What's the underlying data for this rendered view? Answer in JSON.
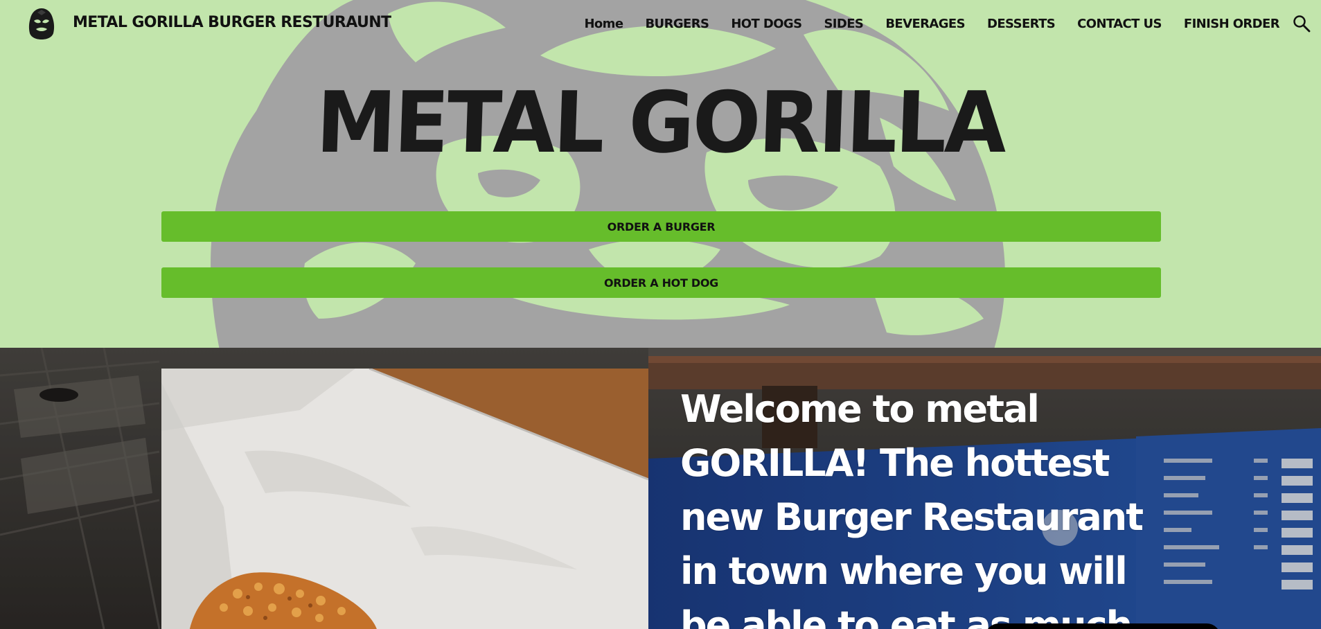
{
  "header": {
    "site_title": "METAL GORILLA BURGER RESTURAUNT",
    "logo_icon": "gorilla-head-icon",
    "nav": [
      {
        "label": "Home"
      },
      {
        "label": "BURGERS"
      },
      {
        "label": "HOT DOGS"
      },
      {
        "label": "SIDES"
      },
      {
        "label": "BEVERAGES"
      },
      {
        "label": "DESSERTS"
      },
      {
        "label": "CONTACT US"
      },
      {
        "label": "FINISH ORDER"
      }
    ],
    "search_icon": "search-icon"
  },
  "hero": {
    "title": "METAL GORILLA",
    "buttons": {
      "burger": "ORDER A BURGER",
      "hotdog": "ORDER A HOT DOG"
    }
  },
  "welcome": {
    "text": "Welcome to metal GORILLA! The hottest new Burger Restaurant in town where you will be able to eat as much"
  },
  "colors": {
    "hero_bg": "#c2e5ac",
    "gorilla_shape": "#a3a3a3",
    "button_green": "#66bd2b",
    "text_dark": "#111111",
    "welcome_text": "#ffffff"
  }
}
